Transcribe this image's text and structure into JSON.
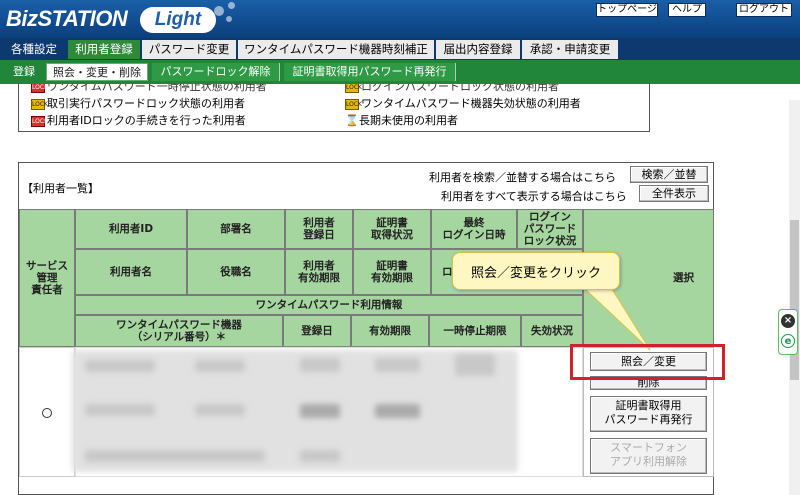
{
  "app": {
    "logo_main": "BizSTATION",
    "logo_sub": "Light"
  },
  "header_buttons": {
    "top": "トップページ",
    "help": "ヘルプ",
    "logout": "ログアウト"
  },
  "nav1": {
    "section": "各種設定",
    "items": [
      "利用者登録",
      "パスワード変更",
      "ワンタイムパスワード機器時刻補正",
      "届出内容登録",
      "承認・申請変更"
    ]
  },
  "nav2": {
    "items": [
      "登録",
      "照会・変更・削除",
      "パスワードロック解除",
      "証明書取得用パスワード再発行"
    ]
  },
  "legend": {
    "top_left_partial": "ワンタイムパスワード一時停止状態の利用者",
    "top_right_partial": "ログインパスワードロック状態の利用者",
    "txn_lock": "取引実行パスワードロック状態の利用者",
    "otp_invalid": "ワンタイムパスワード機器失効状態の利用者",
    "id_lock": "利用者IDロックの手続きを行った利用者",
    "long_unused": "長期未使用の利用者",
    "lock_icon_text": "LOCK"
  },
  "panel": {
    "title": "【利用者一覧】",
    "search_hint": "利用者を検索／並替する場合はこちら",
    "search_button": "検索／並替",
    "showall_hint": "利用者をすべて表示する場合はこちら",
    "showall_button": "全件表示"
  },
  "table": {
    "service_manager": "サービス\n管理\n責任者",
    "user_id": "利用者ID",
    "dept": "部署名",
    "reg_date": "利用者\n登録日",
    "cert_status": "証明書\n取得状況",
    "last_login": "最終\nログイン日時",
    "login_lock": "ログイン\nパスワード\nロック状況",
    "user_name": "利用者名",
    "position": "役職名",
    "valid_until": "利用者\n有効期限",
    "cert_valid": "証明書\n有効期限",
    "last_login_partial": "ロ",
    "select": "選択",
    "otp_info": "ワンタイムパスワード利用情報",
    "otp_device": "ワンタイムパスワード機器\n（シリアル番号）＊",
    "otp_reg_date": "登録日",
    "otp_valid": "有効期限",
    "otp_suspend": "一時停止期限",
    "otp_invalid": "失効状況"
  },
  "actions": {
    "inquiry": "照会／変更",
    "delete": "削除",
    "cert_reissue": "証明書取得用\nパスワード再発行",
    "smartphone": "スマートフォン\nアプリ利用解除"
  },
  "callout": {
    "text": "照会／変更をクリック"
  },
  "colors": {
    "header_bg": "#0b3f7e",
    "nav_green": "#22863a",
    "table_header_green": "#a6d6a0",
    "highlight_red": "#d3202a",
    "callout_bg": "#fff7c2"
  }
}
